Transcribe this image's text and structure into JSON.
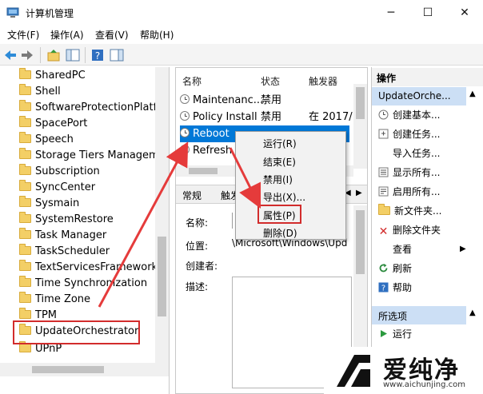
{
  "window": {
    "title": "计算机管理",
    "minimize_glyph": "─",
    "maximize_glyph": "☐",
    "close_glyph": "✕"
  },
  "menubar": {
    "items": [
      "文件(F)",
      "操作(A)",
      "查看(V)",
      "帮助(H)"
    ]
  },
  "tree": {
    "items": [
      "SharedPC",
      "Shell",
      "SoftwareProtectionPlatfor",
      "SpacePort",
      "Speech",
      "Storage Tiers Manageme",
      "Subscription",
      "SyncCenter",
      "Sysmain",
      "SystemRestore",
      "Task Manager",
      "TaskScheduler",
      "TextServicesFramework",
      "Time Synchronization",
      "Time Zone",
      "TPM",
      "UpdateOrchestrator",
      "UPnP"
    ],
    "selected": "UpdateOrchestrator"
  },
  "task_list": {
    "columns": [
      "名称",
      "状态",
      "触发器"
    ],
    "rows": [
      {
        "name": "Maintenanc...",
        "status": "禁用",
        "trigger": ""
      },
      {
        "name": "Policy Install",
        "status": "禁用",
        "trigger": "在 2017/"
      },
      {
        "name": "Reboot",
        "status": "",
        "trigger": ""
      },
      {
        "name": "Refresh S",
        "status": "",
        "trigger": ""
      }
    ],
    "selected": "Reboot"
  },
  "details": {
    "tabs": [
      "常规",
      "触发"
    ],
    "labels": {
      "name": "名称:",
      "location": "位置:",
      "author": "创建者:",
      "description": "描述:"
    },
    "location_value": "\\Microsoft\\Windows\\Upd"
  },
  "context_menu": {
    "items": [
      "运行(R)",
      "结束(E)",
      "禁用(I)",
      "导出(X)...",
      "属性(P)",
      "删除(D)"
    ],
    "highlighted": "属性(P)"
  },
  "actions": {
    "header": "操作",
    "section1": "UpdateOrche...",
    "items1": [
      "创建基本...",
      "创建任务...",
      "导入任务...",
      "显示所有...",
      "启用所有...",
      "新文件夹...",
      "删除文件夹",
      "查看",
      "刷新",
      "帮助"
    ],
    "section2": "所选项",
    "items2": [
      "运行"
    ]
  },
  "watermark": {
    "brand": "爱纯净",
    "url": "www.aichunjing.com"
  },
  "colors": {
    "accent": "#0078d7",
    "highlight_red": "#d22c2c",
    "folder": "#f3cf66"
  }
}
